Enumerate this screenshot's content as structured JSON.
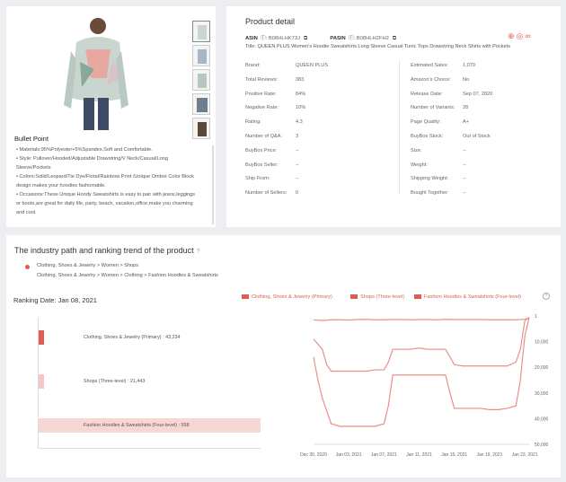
{
  "bullet": {
    "title": "Bullet Point",
    "items": [
      "• Materials:95%Polyester+5%Spandex,Soft and Comfortable.",
      "• Style: Pullover/Hooded/Adjustable Drawstring/V Neck/Casual/Long",
      "   Sleeve/Pockets",
      "• Colors:Solid/Leopard/Tie Dye/Floral/Rainbow Print /Unique Ombre Color Block",
      "   design makes your hoodies fashionable.",
      "• Occasions:These Unique Hoody Sweatshirts is easy to pair with jeans,leggings",
      "   or boots,are great for daily life, party, beach, vacation,office,make you charming",
      "   and cool."
    ]
  },
  "detail": {
    "title": "Product detail",
    "asin_label": "ASIN",
    "asin_value": "B08HLHK73J",
    "pasin_label": "PASIN",
    "pasin_value": "B08HLH2FH2",
    "product_title": "Title: QUEEN PLUS Women's Hoodie Sweatshirts Long Sleeve Casual Tunic Tops Drawstring Neck Shirts with Pockets",
    "left_rows": [
      {
        "k": "Brand:",
        "v": "QUEEN PLUS"
      },
      {
        "k": "Total Reviews:",
        "v": "383"
      },
      {
        "k": "Positive Rate:",
        "v": "84%"
      },
      {
        "k": "Negative Rate:",
        "v": "10%"
      },
      {
        "k": "Rating:",
        "v": "4.3"
      },
      {
        "k": "Number of Q&A:",
        "v": "3"
      },
      {
        "k": "BuyBox Price:",
        "v": "--"
      },
      {
        "k": "BuyBox Seller:",
        "v": "--"
      },
      {
        "k": "Ship From:",
        "v": "--"
      },
      {
        "k": "Number of Sellers:",
        "v": "0"
      }
    ],
    "right_rows": [
      {
        "k": "Estimated Sales:",
        "v": "1,079"
      },
      {
        "k": "Amazon's Choice:",
        "v": "No"
      },
      {
        "k": "Release Date:",
        "v": "Sep 07, 2020"
      },
      {
        "k": "Number of Variants:",
        "v": "28"
      },
      {
        "k": "Page Quality:",
        "v": "A+"
      },
      {
        "k": "BuyBox Stock:",
        "v": "Out of Stock"
      },
      {
        "k": "Size:",
        "v": "--"
      },
      {
        "k": "Weight:",
        "v": "--"
      },
      {
        "k": "Shipping Weight:",
        "v": "--"
      },
      {
        "k": "Bought Together:",
        "v": "--"
      }
    ]
  },
  "trend": {
    "title": "The industry path and ranking trend of the product",
    "path1": "Clothing, Shoes & Jewelry > Women > Shops",
    "path2": "Clothing, Shoes & Jewelry > Women > Clothing > Fashion Hoodies & Sweatshirts",
    "ranking_date": "Ranking Date: Jan 08, 2021",
    "legend": [
      "Clothing, Shoes & Jewelry  (Primary)",
      "Shops  (Three-level)",
      "Fashion Hoodies & Sweatshirts  (Four-level)"
    ],
    "bars": [
      {
        "label": "Clothing, Shoes & Jewelry  (Primary) : 43,234",
        "value": 43234,
        "color": "#e05b53"
      },
      {
        "label": "Shops  (Three-level) : 21,443",
        "value": 21443,
        "color": "#f5c8c5"
      },
      {
        "label": "Fashion Hoodies & Sweatshirts  (Four-level) : 558",
        "value": 558,
        "color": "#f8d6d4"
      }
    ]
  },
  "chart_data": {
    "type": "line",
    "x": [
      "Dec 30, 2020",
      "Jan 03, 2021",
      "Jan 07, 2021",
      "Jan 11, 2021",
      "Jan 15, 2021",
      "Jan 19, 2021",
      "Jan 23, 2021"
    ],
    "yticks": [
      "1",
      "10,000",
      "20,000",
      "30,000",
      "40,000",
      "50,000"
    ],
    "ylim": [
      1,
      50000
    ],
    "series": [
      {
        "name": "Clothing, Shoes & Jewelry  (Primary)",
        "values": [
          [
            0,
            1500
          ],
          [
            1,
            1800
          ],
          [
            2,
            1500
          ],
          [
            3,
            1500
          ],
          [
            4,
            1600
          ],
          [
            5,
            1400
          ],
          [
            6,
            1300
          ],
          [
            7,
            1500
          ],
          [
            8,
            1500
          ],
          [
            9,
            1400
          ],
          [
            10,
            1400
          ],
          [
            11,
            1500
          ],
          [
            12,
            1400
          ],
          [
            13,
            1400
          ],
          [
            14,
            1500
          ],
          [
            15,
            1300
          ],
          [
            16,
            1400
          ],
          [
            17,
            1400
          ],
          [
            18,
            1400
          ],
          [
            19,
            1400
          ],
          [
            20,
            1500
          ],
          [
            21,
            1500
          ],
          [
            22,
            1500
          ],
          [
            23,
            1500
          ],
          [
            24,
            1300
          ],
          [
            24.5,
            800
          ]
        ]
      },
      {
        "name": "Shops  (Three-level)",
        "values": [
          [
            0,
            9000
          ],
          [
            1,
            13000
          ],
          [
            1.5,
            19000
          ],
          [
            2,
            21500
          ],
          [
            3,
            21500
          ],
          [
            4,
            21500
          ],
          [
            5,
            21500
          ],
          [
            6,
            21500
          ],
          [
            7,
            21000
          ],
          [
            8,
            21000
          ],
          [
            8.5,
            18000
          ],
          [
            9,
            13000
          ],
          [
            10,
            13000
          ],
          [
            11,
            13000
          ],
          [
            12,
            12500
          ],
          [
            13,
            13000
          ],
          [
            14,
            13000
          ],
          [
            15,
            13000
          ],
          [
            15.5,
            16000
          ],
          [
            16,
            19000
          ],
          [
            17,
            19500
          ],
          [
            18,
            19500
          ],
          [
            19,
            19500
          ],
          [
            20,
            19500
          ],
          [
            21,
            19500
          ],
          [
            22,
            19500
          ],
          [
            23,
            18000
          ],
          [
            23.5,
            13000
          ],
          [
            24,
            2000
          ],
          [
            24.5,
            500
          ]
        ]
      },
      {
        "name": "Fashion Hoodies & Sweatshirts  (Four-level)",
        "values": [
          [
            0,
            16000
          ],
          [
            0.5,
            25000
          ],
          [
            1,
            32000
          ],
          [
            2,
            42000
          ],
          [
            3,
            43000
          ],
          [
            4,
            43000
          ],
          [
            5,
            43000
          ],
          [
            6,
            43000
          ],
          [
            7,
            43000
          ],
          [
            8,
            42000
          ],
          [
            8.5,
            35000
          ],
          [
            9,
            23000
          ],
          [
            10,
            23000
          ],
          [
            11,
            23000
          ],
          [
            12,
            23000
          ],
          [
            13,
            23000
          ],
          [
            14,
            23000
          ],
          [
            15,
            23000
          ],
          [
            15.5,
            30000
          ],
          [
            16,
            36000
          ],
          [
            17,
            36000
          ],
          [
            18,
            36000
          ],
          [
            19,
            36000
          ],
          [
            20,
            36500
          ],
          [
            21,
            36500
          ],
          [
            22,
            36000
          ],
          [
            23,
            35000
          ],
          [
            23.5,
            25000
          ],
          [
            24,
            8000
          ],
          [
            24.5,
            600
          ]
        ]
      }
    ],
    "colors": {
      "line": "#e88f8a",
      "axis": "#999"
    }
  }
}
